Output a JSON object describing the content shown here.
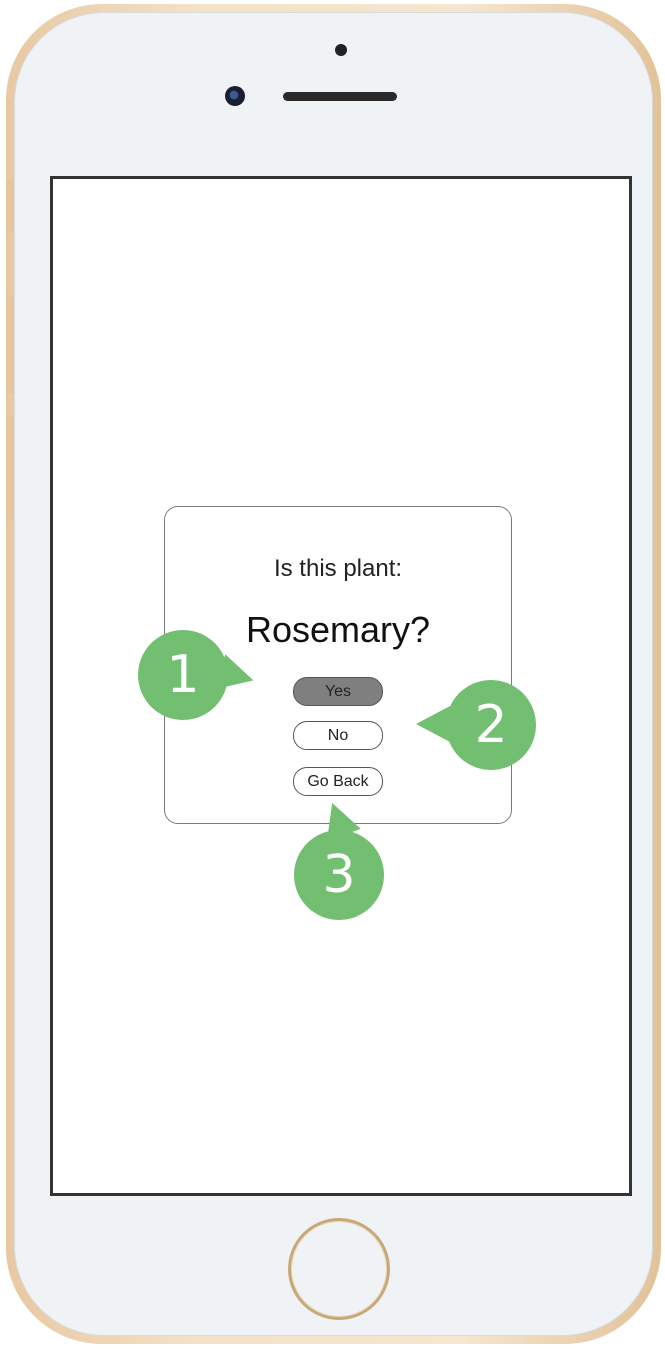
{
  "dialog": {
    "question": "Is this plant:",
    "plant_name": "Rosemary?",
    "buttons": {
      "yes": "Yes",
      "no": "No",
      "go_back": "Go Back"
    }
  },
  "annotations": [
    "1",
    "2",
    "3"
  ],
  "colors": {
    "annotation": "#73bf72",
    "selected_button": "#7f7f7f",
    "phone_frame": "#f4e2c9"
  }
}
